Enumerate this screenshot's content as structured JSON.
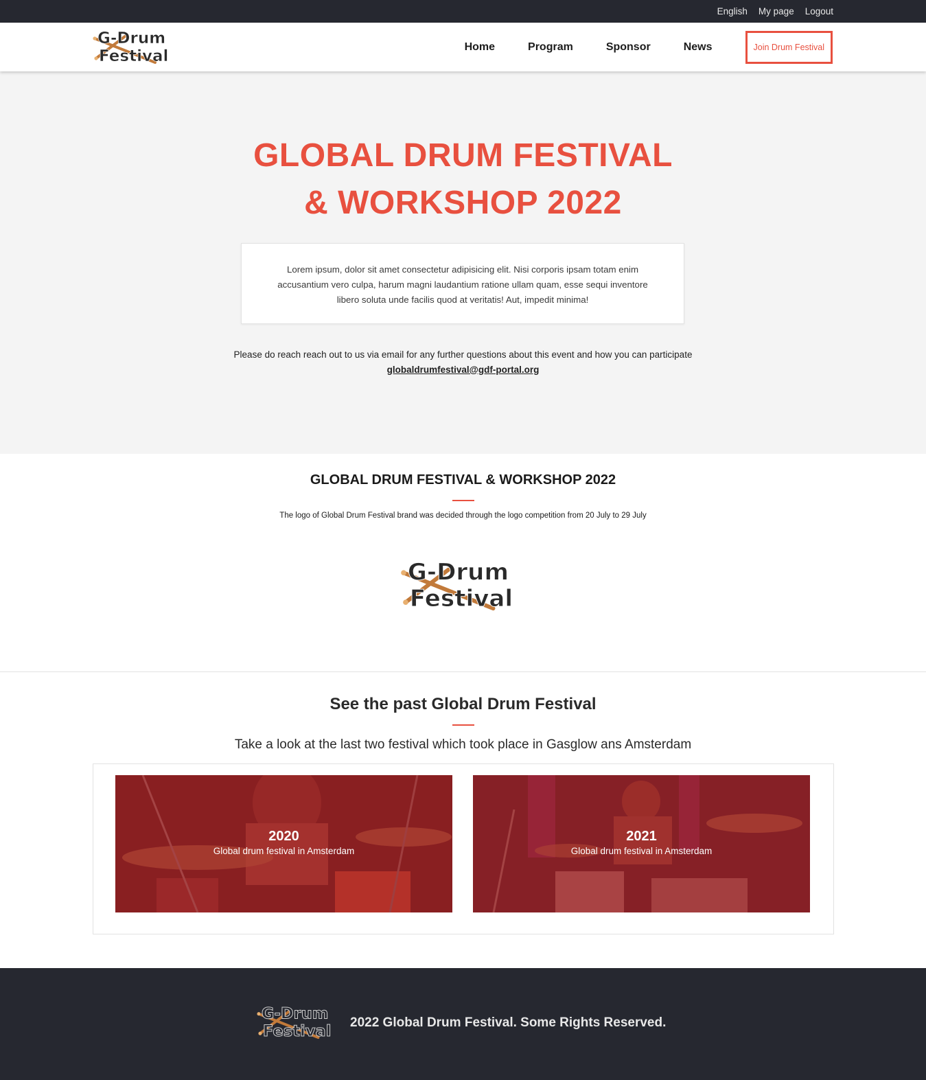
{
  "topbar": {
    "links": [
      "English",
      "My page",
      "Logout"
    ]
  },
  "header": {
    "logo_top": "G-Drum",
    "logo_bottom": "Festival",
    "nav": [
      "Home",
      "Program",
      "Sponsor",
      "News"
    ],
    "join_label": "Join Drum Festival"
  },
  "hero": {
    "title_line1": "GLOBAL DRUM FESTIVAL",
    "title_line2": "& WORKSHOP 2022",
    "card_text": "Lorem ipsum, dolor sit amet consectetur adipisicing elit. Nisi corporis ipsam totam enim accusantium vero culpa, harum magni laudantium ratione ullam quam, esse sequi inventore libero soluta unde facilis quod at veritatis! Aut, impedit minima!",
    "contact_text": "Please do reach reach out to us via email for any further questions about this event and how you can participate",
    "email": "globaldrumfestival@gdf-portal.org"
  },
  "about": {
    "title": "GLOBAL DRUM FESTIVAL & WORKSHOP 2022",
    "text": "The logo of Global Drum Festival brand was decided through the logo competition from 20 July to 29 July"
  },
  "past": {
    "title": "See the past Global Drum Festival",
    "subtitle": "Take a look at the last two festival which took place in Gasglow ans Amsterdam",
    "items": [
      {
        "year": "2020",
        "desc": "Global drum festival in Amsterdam"
      },
      {
        "year": "2021",
        "desc": "Global drum festival in Amsterdam"
      }
    ]
  },
  "footer": {
    "copyright": "2022 Global Drum Festival. Some Rights Reserved."
  },
  "colors": {
    "accent": "#e8503f",
    "dark": "#262830",
    "hero_bg": "#f4f4f4",
    "tile_overlay": "#af282a"
  },
  "icons": {
    "logo": "drumsticks-logo-icon"
  }
}
